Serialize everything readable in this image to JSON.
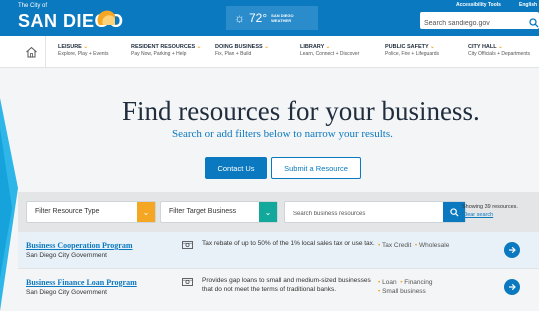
{
  "header": {
    "logo_small": "The City of",
    "logo_big": "SAN DIEGO",
    "weather": {
      "temp": "72°",
      "label_line1": "SAN DIEGO",
      "label_line2": "WEATHER"
    },
    "accessibility_tools": "Accessibility Tools",
    "language": "English",
    "search_placeholder": "Search sandiego.gov",
    "brand_color": "#0b79bf"
  },
  "nav": {
    "items": [
      {
        "title": "LEISURE",
        "subtitle": "Explore, Play + Events"
      },
      {
        "title": "RESIDENT RESOURCES",
        "subtitle": "Pay Now, Parking + Help"
      },
      {
        "title": "DOING BUSINESS",
        "subtitle": "Fix, Plan + Build"
      },
      {
        "title": "LIBRARY",
        "subtitle": "Learn, Connect + Discover"
      },
      {
        "title": "PUBLIC SAFETY",
        "subtitle": "Police, Fire + Lifeguards"
      },
      {
        "title": "CITY HALL",
        "subtitle": "City Officials + Departments"
      }
    ]
  },
  "hero": {
    "title": "Find resources for your business.",
    "subtitle": "Search or add filters below to narrow your results.",
    "contact_label": "Contact Us",
    "submit_label": "Submit a Resource"
  },
  "filters": {
    "resource_type": "Filter Resource Type",
    "target_business": "Filter Target Business",
    "search_placeholder": "Search business resources",
    "count_text": "Showing 39 resources.",
    "clear_label": "Clear search",
    "accent_orange": "#f5a623",
    "accent_teal": "#12a89b"
  },
  "results": [
    {
      "title": "Business Cooperation Program",
      "org": "San Diego City Government",
      "desc": "Tax rebate of up to 50% of the 1% local sales tax or use tax.",
      "tags": [
        "Tax Credit",
        "Wholesale"
      ]
    },
    {
      "title": "Business Finance Loan Program",
      "org": "San Diego City Government",
      "desc": "Provides gap loans to small and medium-sized businesses that do not meet the terms of traditional banks.",
      "tags": [
        "Loan",
        "Financing",
        "Small business"
      ]
    }
  ]
}
